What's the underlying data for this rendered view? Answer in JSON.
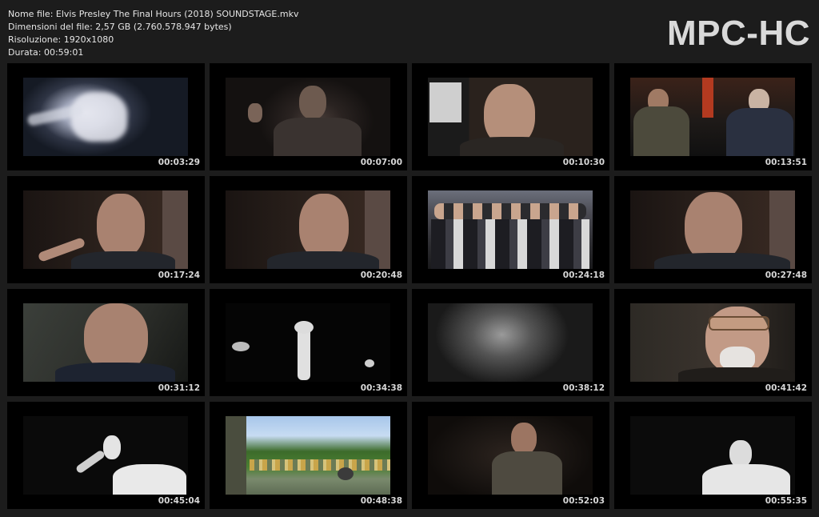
{
  "info": {
    "filename": "Nome file: Elvis Presley The Final Hours (2018) SOUNDSTAGE.mkv",
    "filesize": "Dimensioni del file: 2,57 GB (2.760.578.947 bytes)",
    "resolution": "Risoluzione: 1920x1080",
    "duration": "Durata: 00:59:01"
  },
  "logo": "MPC-HC",
  "thumbnails": [
    {
      "time": "00:03:29"
    },
    {
      "time": "00:07:00"
    },
    {
      "time": "00:10:30"
    },
    {
      "time": "00:13:51"
    },
    {
      "time": "00:17:24"
    },
    {
      "time": "00:20:48"
    },
    {
      "time": "00:24:18"
    },
    {
      "time": "00:27:48"
    },
    {
      "time": "00:31:12"
    },
    {
      "time": "00:34:38"
    },
    {
      "time": "00:38:12"
    },
    {
      "time": "00:41:42"
    },
    {
      "time": "00:45:04"
    },
    {
      "time": "00:48:38"
    },
    {
      "time": "00:52:03"
    },
    {
      "time": "00:55:35"
    }
  ]
}
